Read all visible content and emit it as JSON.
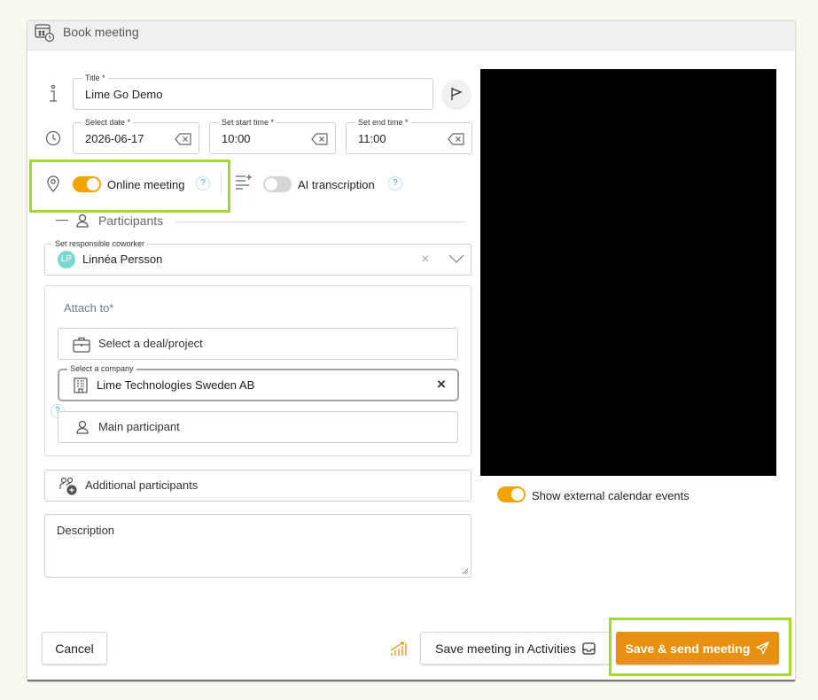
{
  "header": {
    "title": "Book meeting"
  },
  "title_field": {
    "label": "Title *",
    "value": "Lime Go Demo"
  },
  "date_field": {
    "label": "Select date *",
    "value": "2026-06-17"
  },
  "start_field": {
    "label": "Set start time *",
    "value": "10:00"
  },
  "end_field": {
    "label": "Set end time *",
    "value": "11:00"
  },
  "online_meeting": {
    "label": "Online meeting",
    "enabled": true,
    "help": "?"
  },
  "ai_transcription": {
    "label": "AI transcription",
    "enabled": false,
    "help": "?"
  },
  "participants": {
    "section_label": "Participants",
    "collapse_symbol": "—",
    "coworker_label": "Set responsible coworker",
    "coworker_initials": "LP",
    "coworker_name": "Linnéa Persson"
  },
  "attach": {
    "title": "Attach to*",
    "deal_placeholder": "Select a deal/project",
    "company_label": "Select a company",
    "company_value": "Lime Technologies Sweden AB",
    "help": "?",
    "main_participant": "Main participant"
  },
  "additional_participants": "Additional participants",
  "description_placeholder": "Description",
  "external_calendar": {
    "label": "Show external calendar events",
    "enabled": true
  },
  "footer": {
    "cancel": "Cancel",
    "save_activities": "Save meeting in Activities",
    "save_send": "Save & send meeting"
  },
  "colors": {
    "accent": "#e8900f",
    "highlight": "#a3d92f",
    "help": "#3aa4c8"
  }
}
